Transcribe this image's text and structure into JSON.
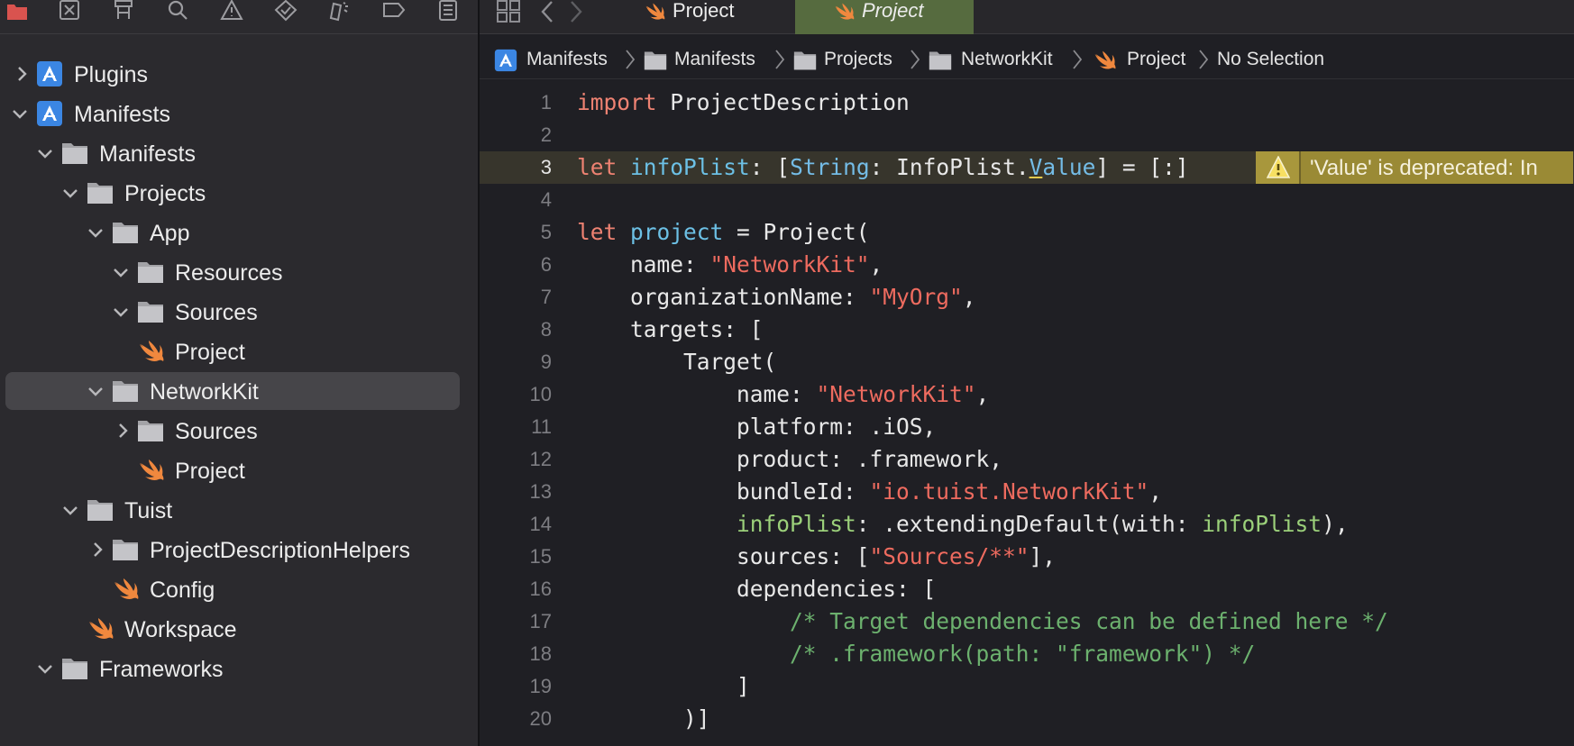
{
  "sidebar": {
    "toolbar_icons": [
      "folder-icon",
      "source-control-icon",
      "hierarchy-icon",
      "search-icon",
      "issue-icon",
      "test-icon",
      "debug-icon",
      "breakpoint-icon",
      "report-icon"
    ],
    "items": [
      {
        "label": "Plugins",
        "kind": "project",
        "expanded": false
      },
      {
        "label": "Manifests",
        "kind": "project",
        "expanded": true
      },
      {
        "label": "Manifests",
        "kind": "folder",
        "expanded": true
      },
      {
        "label": "Projects",
        "kind": "folder",
        "expanded": true
      },
      {
        "label": "App",
        "kind": "folder",
        "expanded": true
      },
      {
        "label": "Resources",
        "kind": "folder",
        "expanded": true
      },
      {
        "label": "Sources",
        "kind": "folder",
        "expanded": true
      },
      {
        "label": "Project",
        "kind": "swift"
      },
      {
        "label": "NetworkKit",
        "kind": "folder",
        "expanded": true,
        "selected": true
      },
      {
        "label": "Sources",
        "kind": "folder",
        "expanded": false
      },
      {
        "label": "Project",
        "kind": "swift"
      },
      {
        "label": "Tuist",
        "kind": "folder",
        "expanded": true
      },
      {
        "label": "ProjectDescriptionHelpers",
        "kind": "folder",
        "expanded": false
      },
      {
        "label": "Config",
        "kind": "swift"
      },
      {
        "label": "Workspace",
        "kind": "swift"
      },
      {
        "label": "Frameworks",
        "kind": "folder",
        "expanded": true
      }
    ]
  },
  "tabs": [
    {
      "label": "Project",
      "active": false
    },
    {
      "label": "Project",
      "active": true
    }
  ],
  "breadcrumb": [
    "Manifests",
    "Manifests",
    "Projects",
    "NetworkKit",
    "Project",
    "No Selection"
  ],
  "code": {
    "lines": [
      "1",
      "2",
      "3",
      "4",
      "5",
      "6",
      "7",
      "8",
      "9",
      "10",
      "11",
      "12",
      "13",
      "14",
      "15",
      "16",
      "17",
      "18",
      "19",
      "20"
    ],
    "warning": "'Value' is deprecated: In"
  },
  "colors": {
    "keyword": "#ee8272",
    "string": "#ee6b5f",
    "type": "#74bce6",
    "comment": "#6cb16e",
    "warning": "#9a8a35",
    "swift": "#f0883e",
    "project_icon": "#3b86e3"
  }
}
